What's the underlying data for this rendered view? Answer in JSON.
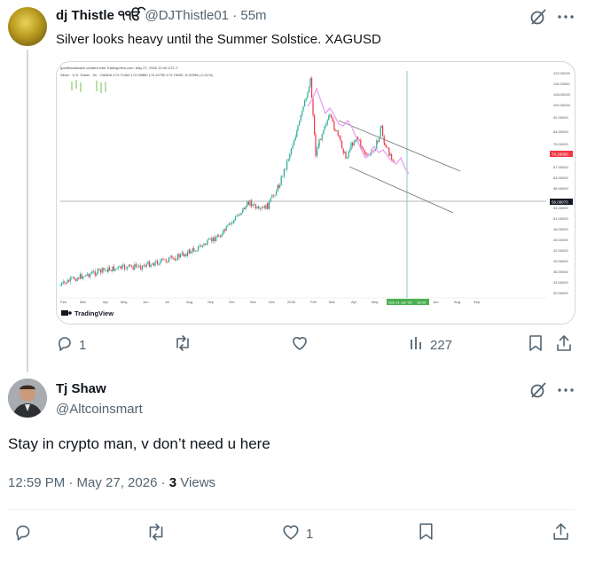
{
  "original_post": {
    "author_name": "dj Thistle ੧ੴ",
    "handle": "@DJThistle01",
    "separator": "·",
    "time_ago": "55m",
    "text": "Silver looks heavy until the Summer Solstice. XAGUSD",
    "chart": {
      "header_line": "goldthreadwave created with TradingView.com, May 27, 2026 12:49 UTC-7",
      "symbol_line": "Silver · U.S. Dollar · 4h · OANDA  174.71400  174.99850  174.42750  174.78050  -0.02398 (-0.01%)",
      "watermark": "TradingView",
      "x_ticks": [
        "Feb",
        "Mar",
        "Apr",
        "May",
        "Jun",
        "Jul",
        "Aug",
        "Sep",
        "Oct",
        "Nov",
        "Dec",
        "2026",
        "Feb",
        "Mar",
        "Apr",
        "May",
        "Jun",
        "Aug",
        "Sep"
      ],
      "date_badge": "Sun 21 Jun '26",
      "time_badge": "15:00",
      "y_ticks": [
        "120.00000",
        "116.00000",
        "108.00000",
        "100.00000",
        "92.00000",
        "84.00000",
        "76.00000",
        "67.00000",
        "63.00000",
        "58.00000",
        "54.00000",
        "51.00000",
        "48.00000",
        "45.00000",
        "42.00000",
        "39.00000",
        "36.00000",
        "33.00000",
        "30.00000",
        "27.00000"
      ],
      "price_badge_red": "74.29000",
      "price_badge_dark": "56.08876",
      "colors": {
        "up": "#22ab94",
        "down": "#f23645",
        "projection": "#e9a6f0",
        "channel": "#7a7a7a",
        "vline": "#80cbc4"
      }
    },
    "actions": {
      "replies": "1",
      "retweets": "",
      "likes": "",
      "views": "227"
    }
  },
  "reply": {
    "author_name": "Tj Shaw",
    "handle": "@Altcoinsmart",
    "text": "Stay in crypto man, v don’t need u here",
    "timestamp": "12:59 PM · May 27, 2026 ·",
    "views_count": "3",
    "views_label": "Views",
    "actions": {
      "replies": "",
      "retweets": "",
      "likes": "1"
    }
  },
  "icons": {
    "grok": "grok-icon",
    "more": "more-icon",
    "reply": "reply-icon",
    "retweet": "retweet-icon",
    "like": "like-icon",
    "views": "views-icon",
    "bookmark": "bookmark-icon",
    "share": "share-icon"
  },
  "theme": {
    "text": "#0f1419",
    "muted": "#536471",
    "border": "#cfd9de",
    "thread_line": "#cfd9de"
  }
}
